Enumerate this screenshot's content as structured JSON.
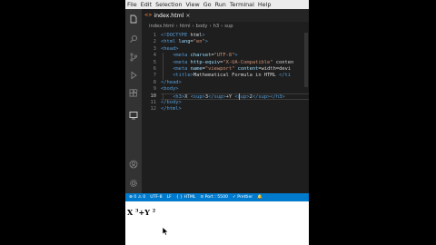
{
  "menu": [
    "File",
    "Edit",
    "Selection",
    "View",
    "Go",
    "Run",
    "Terminal",
    "Help"
  ],
  "tab": {
    "icon": "<>",
    "label": "index.html",
    "close": "×"
  },
  "breadcrumb": [
    "index.html",
    "›",
    "html",
    "›",
    "body",
    "›",
    "h3",
    "›",
    "sup"
  ],
  "line_numbers": [
    "1",
    "2",
    "3",
    "4",
    "5",
    "6",
    "7",
    "8",
    "9",
    "10",
    "11",
    "12"
  ],
  "code_lines": [
    {
      "n": "1",
      "text": "<!DOCTYPE html>",
      "indent": 0
    },
    {
      "n": "2",
      "text": "<html lang=\"en\">",
      "indent": 0
    },
    {
      "n": "3",
      "text": "<head>",
      "indent": 0
    },
    {
      "n": "4",
      "text": "<meta charset=\"UTF-8\">",
      "indent": 2
    },
    {
      "n": "5",
      "text": "<meta http-equiv=\"X-UA-Compatible\" conten",
      "indent": 2
    },
    {
      "n": "6",
      "text": "<meta name=\"viewport\" content=\"width=devi",
      "indent": 2
    },
    {
      "n": "7",
      "text": "<title>Mathematical Formula in HTML </ti",
      "indent": 2
    },
    {
      "n": "8",
      "text": "</head>",
      "indent": 0
    },
    {
      "n": "9",
      "text": "<body>",
      "indent": 0
    },
    {
      "n": "10",
      "text": "<h3>X <sup>3</sup>+Y <sup>2</sup></h3>",
      "indent": 2
    },
    {
      "n": "11",
      "text": "</body>",
      "indent": 0
    },
    {
      "n": "12",
      "text": "</html>",
      "indent": 0
    }
  ],
  "current_line": "10",
  "status": [
    "⊗ 0 ⚠ 0",
    "UTF-8",
    "LF",
    "{ } HTML",
    "⊙ Port : 5500",
    "✓ Prettier",
    "🔔"
  ],
  "preview": {
    "base1": "X",
    "sup1": "3",
    "plus": "+Y",
    "sup2": "2"
  },
  "colors": {
    "statusbar": "#007acc",
    "activity": "#333333",
    "editor": "#1e1e1e",
    "tag": "#569cd6",
    "attr": "#9cdcfe",
    "string": "#ce9178",
    "text": "#d4d4d4"
  },
  "activity_icons": [
    "files-icon",
    "search-icon",
    "source-control-icon",
    "run-debug-icon",
    "extensions-icon",
    "remote-icon",
    "account-icon",
    "settings-gear-icon"
  ]
}
